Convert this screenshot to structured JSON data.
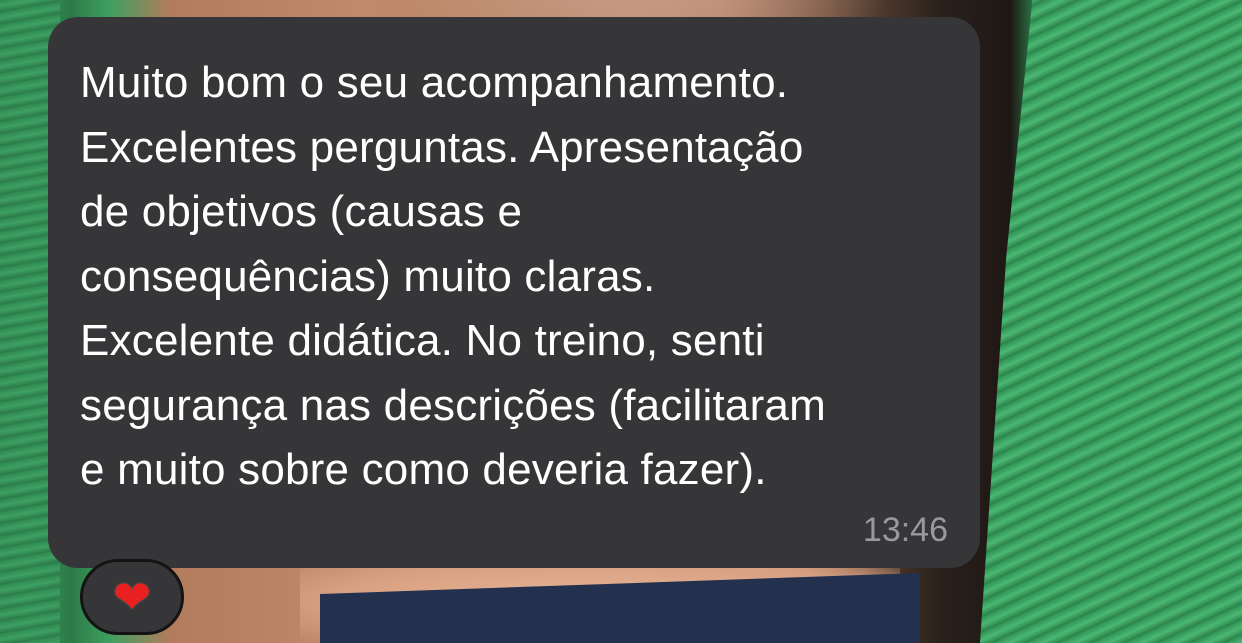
{
  "message": {
    "text": "Muito bom o seu acompanhamento.\nExcelentes perguntas. Apresentação\nde objetivos (causas e\nconsequências) muito claras.\nExcelente didática. No treino, senti\nsegurança nas descrições (facilitaram\ne muito sobre como deveria fazer).",
    "time": "13:46"
  },
  "reaction": {
    "emoji": "❤"
  },
  "colors": {
    "bubble": "#363638",
    "text": "#ffffff",
    "timestamp": "#9a9a9e",
    "heart": "#e8201f"
  }
}
